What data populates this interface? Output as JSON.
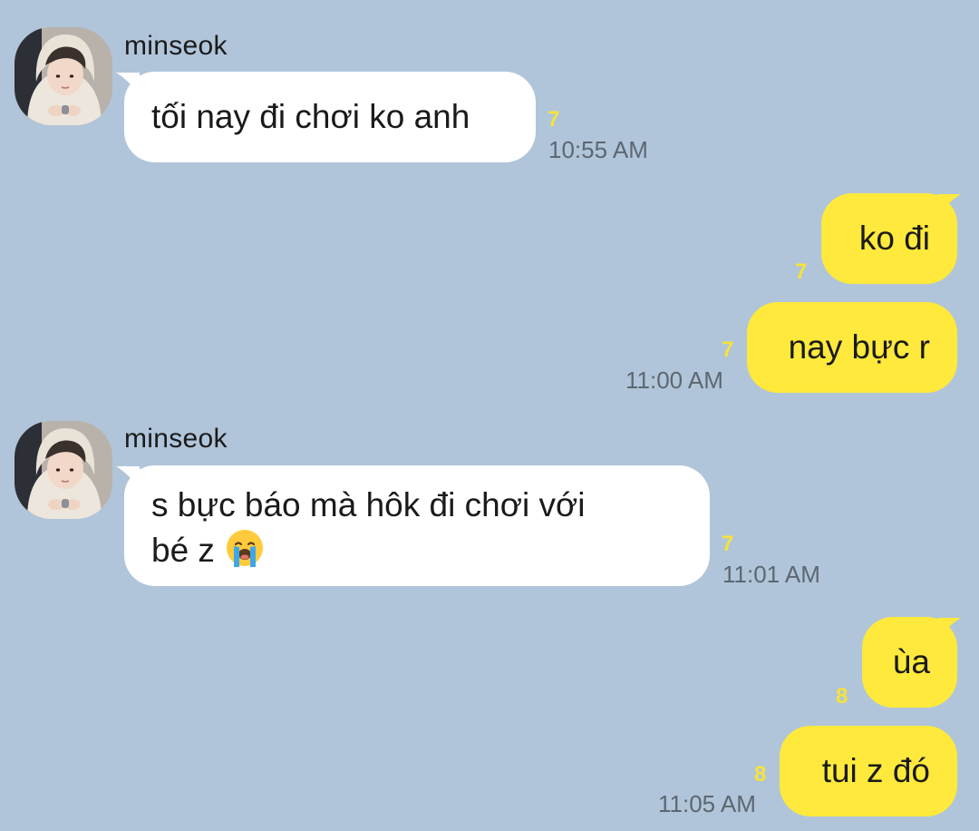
{
  "colors": {
    "chat_background": "#b0c5da",
    "incoming_bubble": "#ffffff",
    "outgoing_bubble": "#fee93c",
    "unread_count": "#f6e33a",
    "timestamp": "#5d6772"
  },
  "messages": [
    {
      "sender": "minseok",
      "direction": "incoming",
      "text": "tối nay đi chơi ko anh",
      "unread": "7",
      "time": "10:55 AM"
    },
    {
      "direction": "outgoing",
      "text": "ko đi",
      "unread": "7",
      "time": ""
    },
    {
      "direction": "outgoing",
      "text": "nay bực r",
      "unread": "7",
      "time": "11:00 AM"
    },
    {
      "sender": "minseok",
      "direction": "incoming",
      "text_line1": "s bực báo mà hôk đi chơi với",
      "text_line2": "bé z",
      "emoji": "loudly-crying-face-icon",
      "unread": "7",
      "time": "11:01 AM"
    },
    {
      "direction": "outgoing",
      "text": "ùa",
      "unread": "8",
      "time": ""
    },
    {
      "direction": "outgoing",
      "text": "tui z đó",
      "unread": "8",
      "time": "11:05 AM"
    }
  ]
}
